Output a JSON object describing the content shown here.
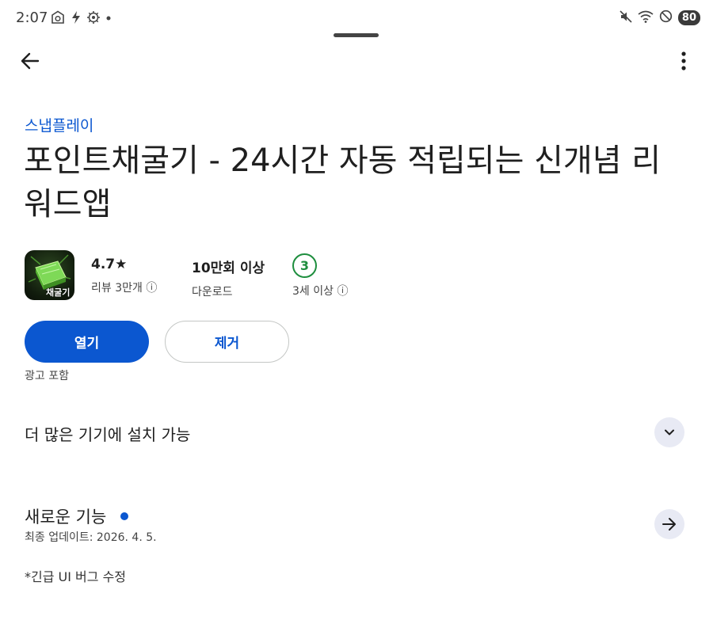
{
  "status_bar": {
    "time": "2:07",
    "left_icons": [
      "camera-app-icon",
      "bolt-icon",
      "settings-gear-icon",
      "dot-icon"
    ],
    "right_icons": [
      "mute-icon",
      "wifi-icon",
      "do-not-disturb-icon"
    ],
    "battery": "80"
  },
  "app_bar": {
    "back_icon": "arrow-left-icon",
    "more_icon": "more-vertical-icon"
  },
  "app": {
    "developer": "스냅플레이",
    "title": "포인트채굴기 - 24시간 자동 적립되는 신개념 리워드앱",
    "icon_label": "채굴기",
    "rating": "4.7★",
    "reviews": "리뷰 3만개 ⓘ",
    "downloads": "10만회 이상",
    "downloads_label": "다운로드",
    "age_rating": "3",
    "age_label": "3세 이상 ⓘ"
  },
  "actions": {
    "open": "열기",
    "remove": "제거",
    "ads_note": "광고 포함"
  },
  "devices": {
    "title": "더 많은 기기에 설치 가능"
  },
  "whats_new": {
    "title": "새로운 기능",
    "updated": "최종 업데이트: 2026. 4. 5.",
    "notes": "*긴급 UI 버그 수정"
  },
  "colors": {
    "accent": "#0b57d0",
    "age_green": "#1e8e3e",
    "chip_bg": "#e8eaf4"
  }
}
